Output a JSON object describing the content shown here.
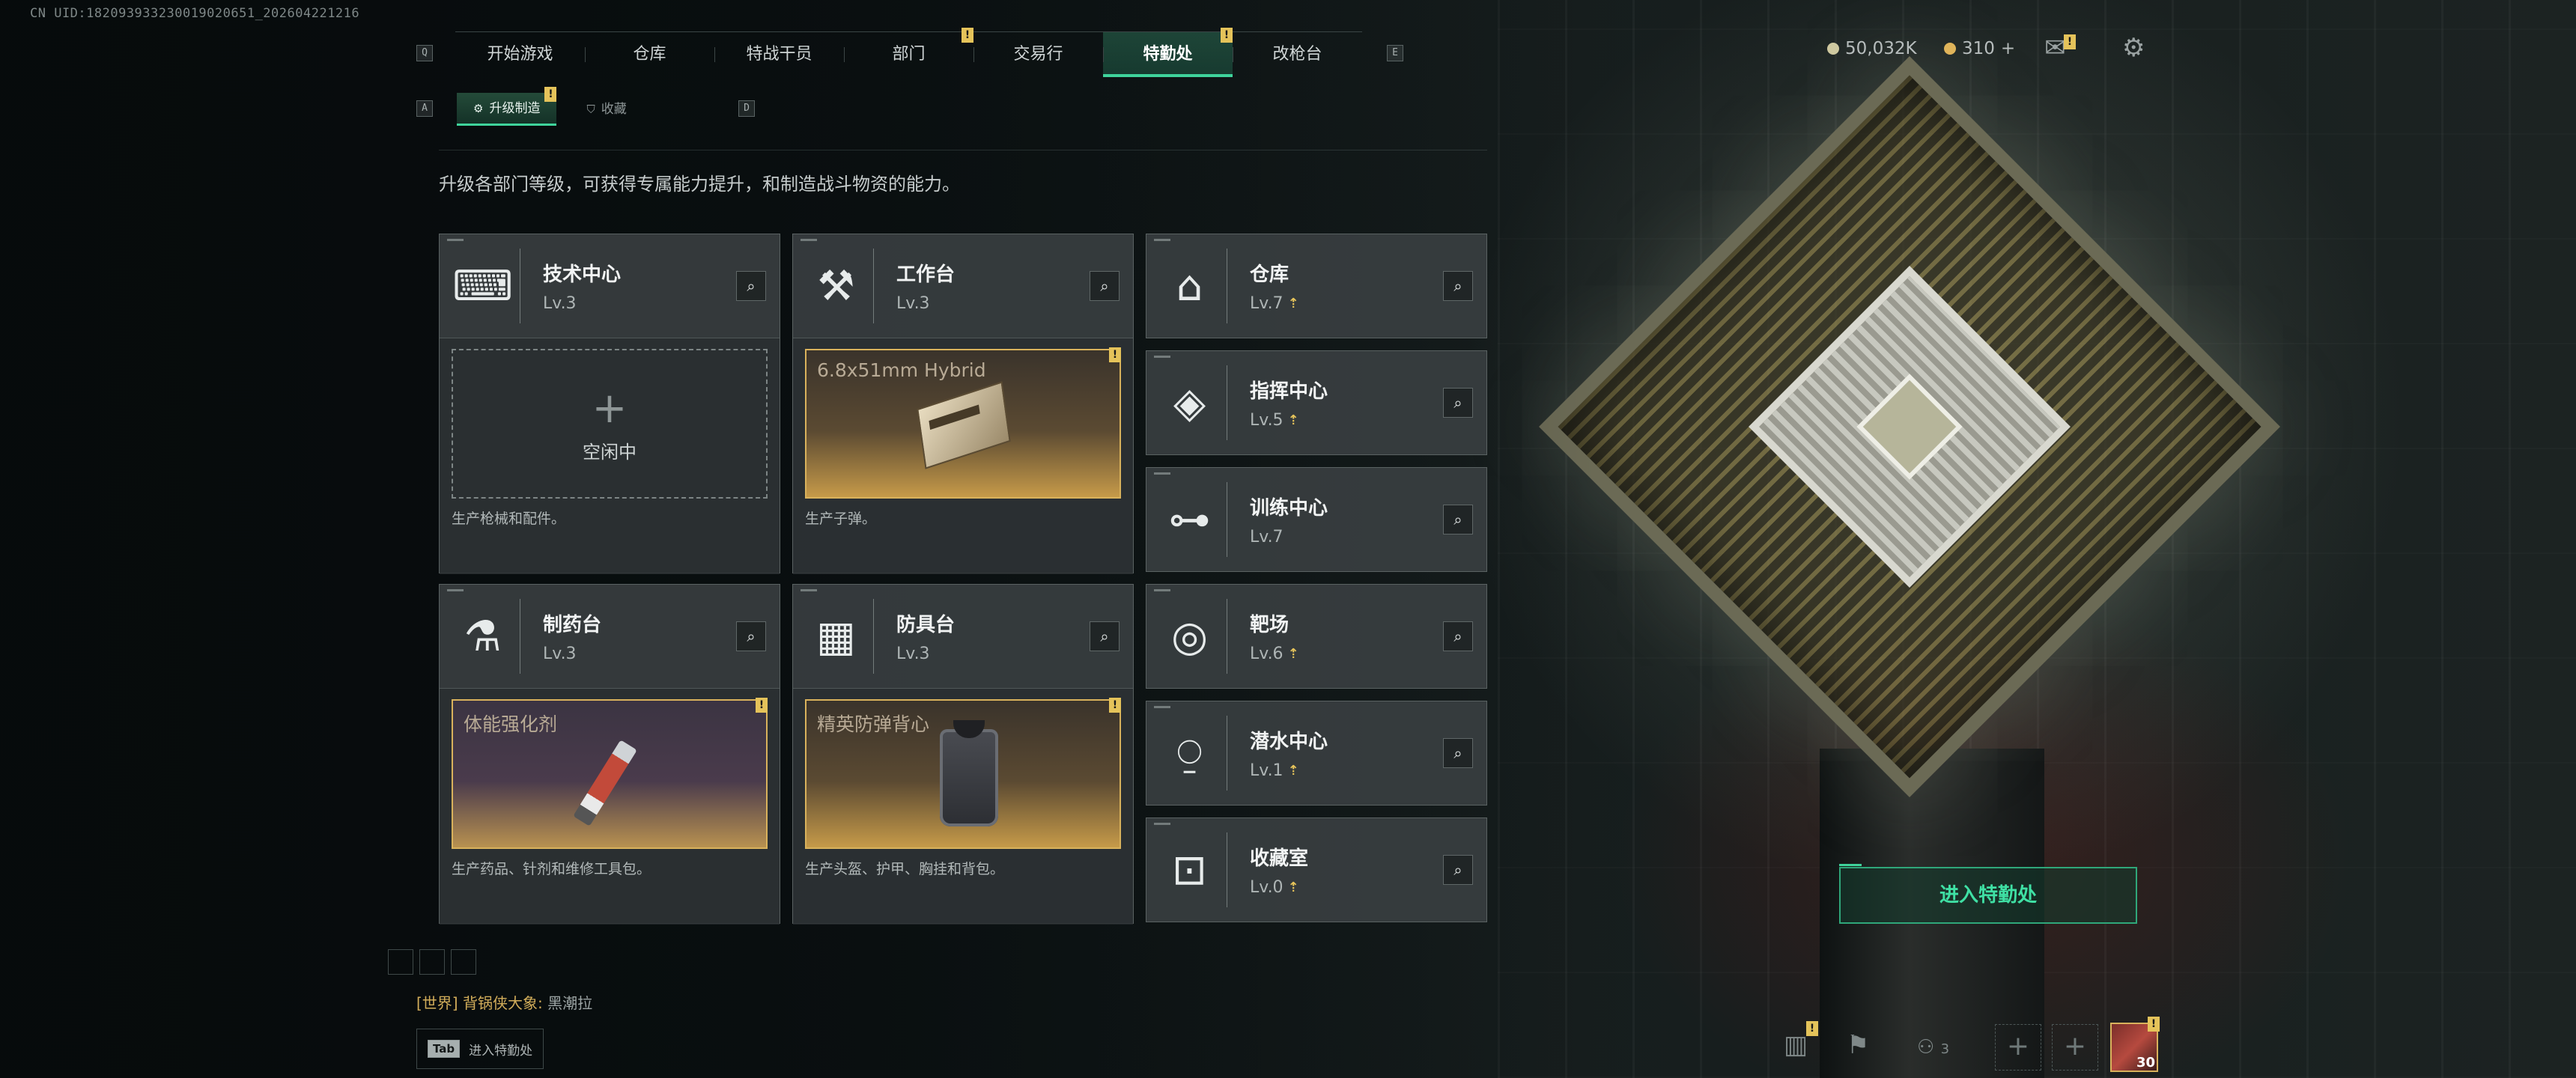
{
  "uid": "CN UID:18209393323001902065​1_202604221216",
  "nav": {
    "left_key": "Q",
    "right_key": "E",
    "tabs": [
      {
        "label": "开始游戏",
        "badge": ""
      },
      {
        "label": "仓库",
        "badge": ""
      },
      {
        "label": "特战干员",
        "badge": ""
      },
      {
        "label": "部门",
        "badge": "!"
      },
      {
        "label": "交易行",
        "badge": ""
      },
      {
        "label": "特勤处",
        "badge": "!"
      },
      {
        "label": "改枪台",
        "badge": ""
      }
    ],
    "active_tab": "特勤处"
  },
  "subnav": {
    "left_key": "A",
    "right_key": "D",
    "tabs": [
      {
        "label": "升级制造",
        "badge": "!"
      },
      {
        "label": "收藏",
        "badge": ""
      }
    ]
  },
  "top_right": {
    "currency_1": "50,032K",
    "currency_2": "310",
    "currency_2_add": "+",
    "mail_badge": "!"
  },
  "description": "升级各部门等级，可获得专属能力提升，和制造战斗物资的能力。",
  "production": [
    {
      "name": "技术中心",
      "level": "Lv.3",
      "icon": "tech-center-icon",
      "slot_state": "idle",
      "idle_text": "空闲中",
      "item_name": "",
      "badge": "",
      "desc": "生产枪械和配件。"
    },
    {
      "name": "工作台",
      "level": "Lv.3",
      "icon": "workbench-icon",
      "slot_state": "item",
      "idle_text": "",
      "item_name": "6.8x51mm Hybrid",
      "badge": "!",
      "desc": "生产子弹。"
    },
    {
      "name": "制药台",
      "level": "Lv.3",
      "icon": "pharmacy-icon",
      "slot_state": "item",
      "idle_text": "",
      "item_name": "体能强化剂",
      "badge": "!",
      "desc": "生产药品、针剂和维修工具包。"
    },
    {
      "name": "防具台",
      "level": "Lv.3",
      "icon": "armor-bench-icon",
      "slot_state": "item",
      "idle_text": "",
      "item_name": "精英防弹背心",
      "badge": "!",
      "desc": "生产头盔、护甲、胸挂和背包。"
    }
  ],
  "facilities": [
    {
      "name": "仓库",
      "level": "Lv.7",
      "upgradable": true,
      "icon": "warehouse-icon"
    },
    {
      "name": "指挥中心",
      "level": "Lv.5",
      "upgradable": true,
      "icon": "command-center-icon"
    },
    {
      "name": "训练中心",
      "level": "Lv.7",
      "upgradable": false,
      "icon": "training-center-icon"
    },
    {
      "name": "靶场",
      "level": "Lv.6",
      "upgradable": true,
      "icon": "shooting-range-icon"
    },
    {
      "name": "潜水中心",
      "level": "Lv.1",
      "upgradable": true,
      "icon": "diving-center-icon"
    },
    {
      "name": "收藏室",
      "level": "Lv.0",
      "upgradable": true,
      "icon": "collection-room-icon"
    }
  ],
  "enter_button": "进入特勤处",
  "chat": {
    "channel": "[世界]",
    "user": "背锅侠大象",
    "separator": ":",
    "message": "黑潮拉"
  },
  "tab_hint": {
    "key": "Tab",
    "label": "进入特勤处"
  },
  "bottom_right": {
    "stats_badge": "!",
    "squad_count": "3",
    "avatar_badge": "!",
    "avatar_level": "30"
  },
  "colors": {
    "accent": "#3fd39b",
    "badge": "#e5c35a",
    "gold_frame": "#d9b25c"
  }
}
